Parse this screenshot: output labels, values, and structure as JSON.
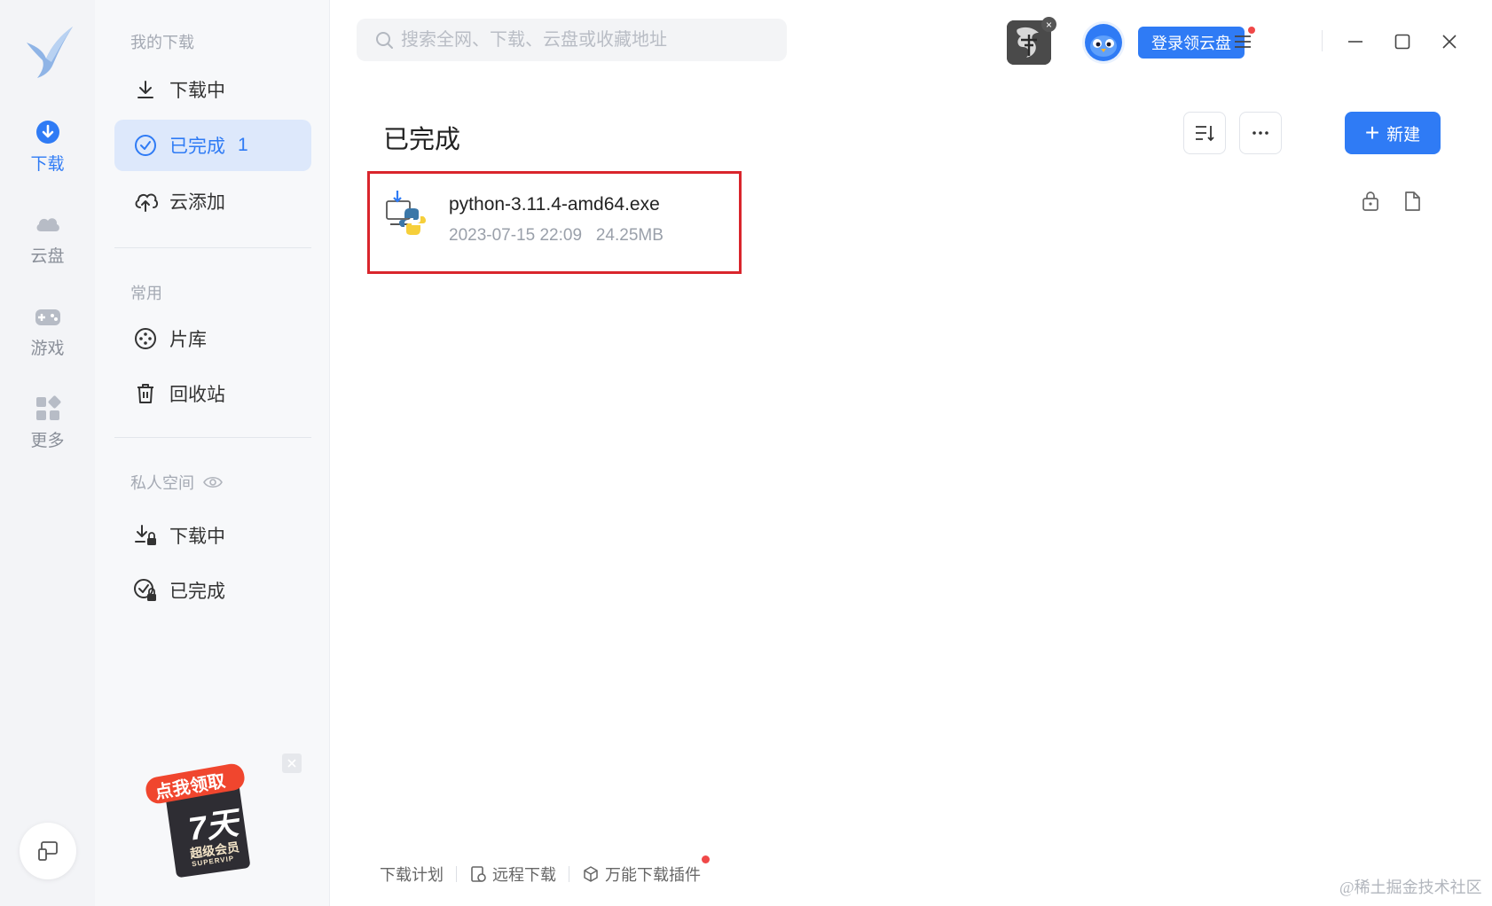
{
  "rail": {
    "items": [
      {
        "label": "下载",
        "icon": "download-circle-icon"
      },
      {
        "label": "云盘",
        "icon": "cloud-icon"
      },
      {
        "label": "游戏",
        "icon": "gamepad-icon"
      },
      {
        "label": "更多",
        "icon": "apps-grid-icon"
      }
    ]
  },
  "sidebar": {
    "my_downloads_heading": "我的下载",
    "downloading": "下载中",
    "completed": "已完成",
    "completed_count": "1",
    "cloud_add": "云添加",
    "common_heading": "常用",
    "library": "片库",
    "recycle": "回收站",
    "private_heading": "私人空间",
    "private_downloading": "下载中",
    "private_completed": "已完成",
    "promo": {
      "line1": "点我领取",
      "line2": "7天",
      "line3": "超级会员",
      "line4": "SUPERVIP"
    }
  },
  "search": {
    "placeholder": "搜索全网、下载、云盘或收藏地址"
  },
  "header": {
    "login_button": "登录领云盘"
  },
  "main": {
    "title": "已完成",
    "new_button": "新建",
    "files": [
      {
        "name": "python-3.11.4-amd64.exe",
        "date": "2023-07-15 22:09",
        "size": "24.25MB"
      }
    ]
  },
  "bottom": {
    "plan": "下载计划",
    "remote": "远程下载",
    "plugin": "万能下载插件"
  },
  "watermark": "@稀土掘金技术社区",
  "colors": {
    "accent": "#2f7bf5",
    "highlight_box": "#d9252c",
    "badge": "#f04848"
  }
}
